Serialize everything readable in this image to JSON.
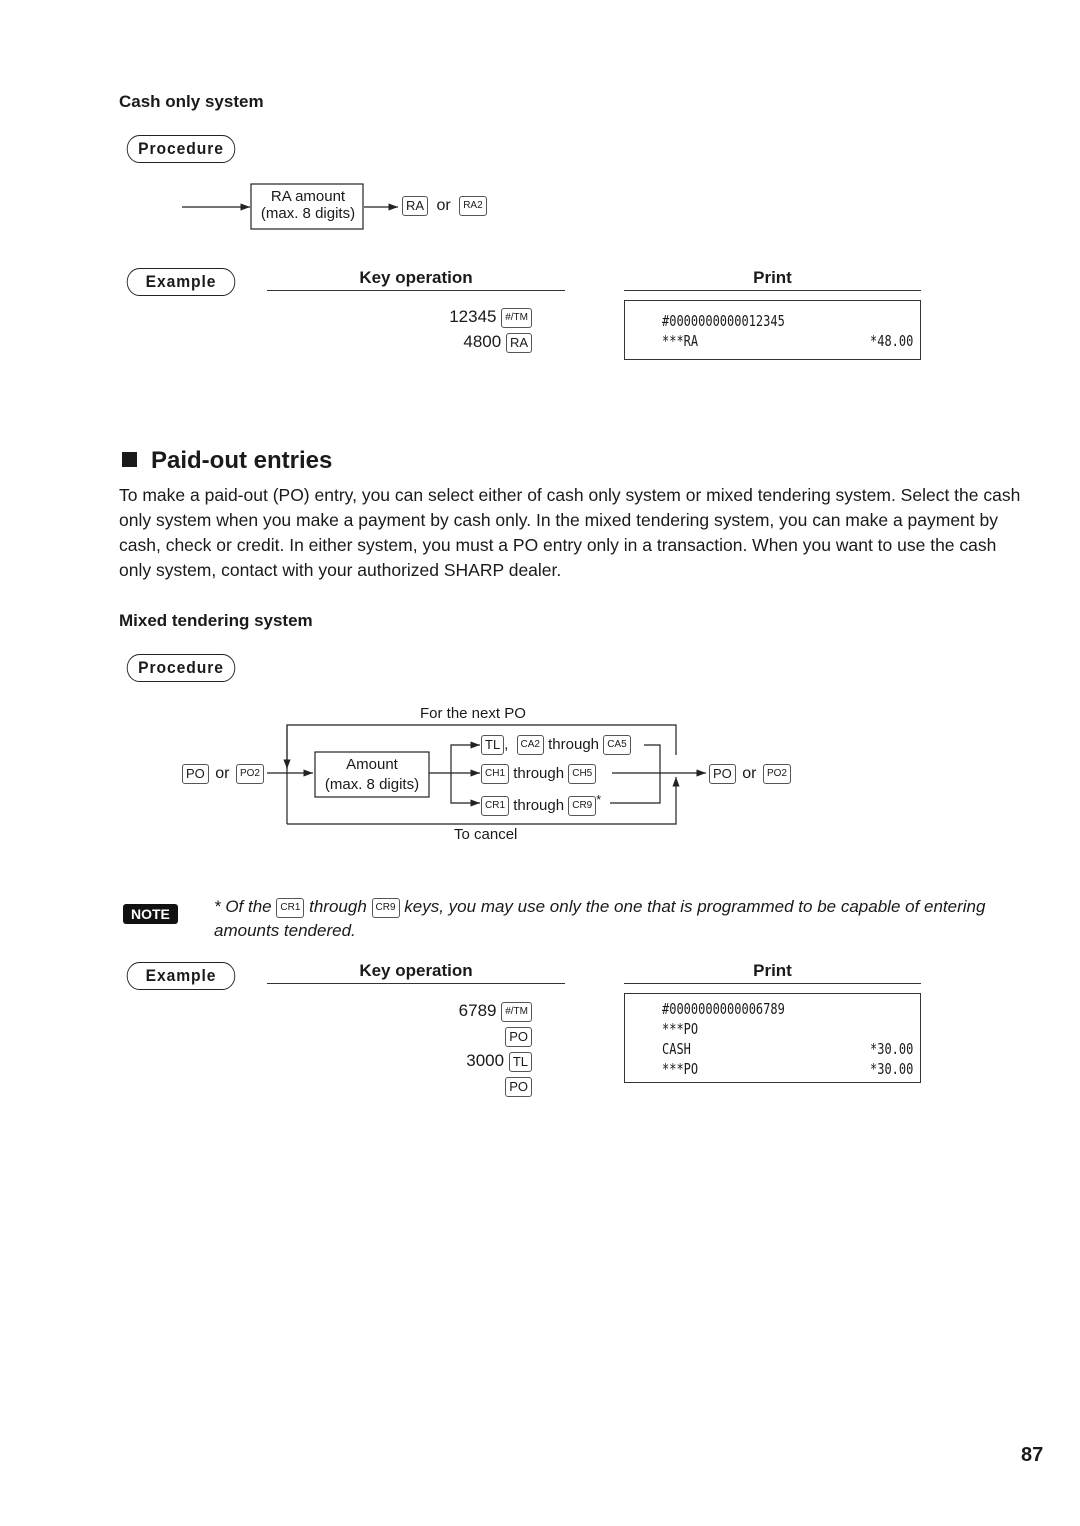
{
  "cash_only": {
    "heading": "Cash only system",
    "procedure_label": "Procedure",
    "flow": {
      "box_line1": "RA amount",
      "box_line2": "(max. 8 digits)",
      "key1": "RA",
      "or": "or",
      "key2": "RA2"
    },
    "example_label": "Example",
    "key_operation_header": "Key operation",
    "print_header": "Print",
    "key_ops": [
      {
        "amount": "12345",
        "key": "#/TM"
      },
      {
        "amount": "4800",
        "key": "RA"
      }
    ],
    "receipt": [
      {
        "label": "#0000000000012345",
        "value": ""
      },
      {
        "label": "***RA",
        "value": "*48.00"
      }
    ]
  },
  "paid_out": {
    "title": "Paid-out entries",
    "description": "To make a paid-out (PO) entry, you can select either of cash only system or mixed tendering system. Select the cash only system when you make a payment by cash only.  In the mixed tendering system, you can make a payment by cash, check or credit.  In either system, you must a PO entry only in a transaction. When you want to use the cash only system, contact with your authorized SHARP dealer.",
    "mixed": {
      "heading": "Mixed tendering system",
      "procedure_label": "Procedure",
      "flow": {
        "start_key1": "PO",
        "start_or": "or",
        "start_key2": "PO2",
        "box_line1": "Amount",
        "box_line2": "(max. 8 digits)",
        "loop_top_label": "For the next PO",
        "loop_bottom_label": "To cancel",
        "branches": [
          {
            "key_a": "TL",
            "sep": ",",
            "key_b": "CA2",
            "through": "through",
            "key_c": "CA5",
            "mark": ""
          },
          {
            "key_a": "CH1",
            "through": "through",
            "key_c": "CH5",
            "mark": ""
          },
          {
            "key_a": "CR1",
            "through": "through",
            "key_c": "CR9",
            "mark": "*"
          }
        ],
        "end_key1": "PO",
        "end_or": "or",
        "end_key2": "PO2"
      },
      "note": {
        "badge": "NOTE",
        "prefix": "* Of the",
        "key1": "CR1",
        "through": "through",
        "key2": "CR9",
        "suffix": "keys, you may use only the one that is programmed to be capable of entering amounts tendered."
      },
      "example_label": "Example",
      "key_operation_header": "Key operation",
      "print_header": "Print",
      "key_ops": [
        {
          "amount": "6789",
          "key": "#/TM"
        },
        {
          "amount": "",
          "key": "PO"
        },
        {
          "amount": "3000",
          "key": "TL"
        },
        {
          "amount": "",
          "key": "PO"
        }
      ],
      "receipt": [
        {
          "label": "#0000000000006789",
          "value": ""
        },
        {
          "label": "***PO",
          "value": ""
        },
        {
          "label": "CASH",
          "value": "*30.00"
        },
        {
          "label": "***PO",
          "value": "*30.00"
        }
      ]
    }
  },
  "page_number": "87"
}
